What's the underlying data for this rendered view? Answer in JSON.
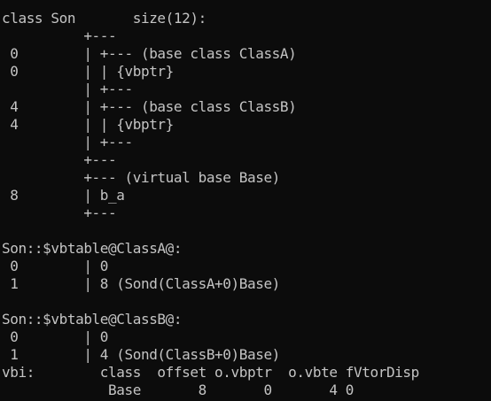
{
  "window": {
    "background": "#0c0c0c",
    "foreground": "#c4c4c4"
  },
  "lines": [
    "class Son       size(12):",
    "          +---",
    " 0        | +--- (base class ClassA)",
    " 0        | | {vbptr}",
    "          | +---",
    " 4        | +--- (base class ClassB)",
    " 4        | | {vbptr}",
    "          | +---",
    "          +---",
    "          +--- (virtual base Base)",
    " 8        | b_a",
    "          +---",
    "",
    "Son::$vbtable@ClassA@:",
    " 0        | 0",
    " 1        | 8 (Sond(ClassA+0)Base)",
    "",
    "Son::$vbtable@ClassB@:",
    " 0        | 0",
    " 1        | 4 (Sond(ClassB+0)Base)",
    "vbi:        class  offset o.vbptr  o.vbte fVtorDisp",
    "             Base       8       0       4 0"
  ]
}
